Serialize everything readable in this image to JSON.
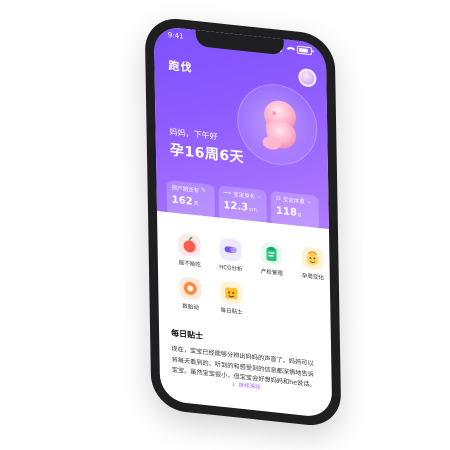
{
  "status_bar": {
    "time": "9:41"
  },
  "app": {
    "title": "跑伐"
  },
  "hero": {
    "greeting": "妈妈，下午好",
    "pregnancy_week_text": "孕16周6天"
  },
  "cards": [
    {
      "label": "预产期还有",
      "value": "162",
      "unit": "天",
      "icon": "edit-icon"
    },
    {
      "label": "宝宝身长",
      "value": "12.3",
      "unit": "cm",
      "icon": "ruler-icon"
    },
    {
      "label": "宝宝体重",
      "value": "118",
      "unit": "g",
      "icon": "scale-icon"
    }
  ],
  "tools": [
    {
      "label": "能不能吃",
      "icon": "apple-icon",
      "color": "#ff6a5a"
    },
    {
      "label": "HCG分析",
      "icon": "capsule-icon",
      "color": "#7a56ff"
    },
    {
      "label": "产检管理",
      "icon": "clipboard-icon",
      "color": "#2bc07c"
    },
    {
      "label": "孕周变化",
      "icon": "baby-face-icon",
      "color": "#ffb200"
    },
    {
      "label": "数胎动",
      "icon": "counter-icon",
      "color": "#ff7a2e"
    },
    {
      "label": "每日贴士",
      "icon": "tips-icon",
      "color": "#ffb200"
    }
  ],
  "tips": {
    "title": "每日贴士",
    "body": "现在，宝宝已经能够分辨出妈妈的声音了。妈妈可以将每天看到的、听到的和感受到的信息都深情地告诉宝宝。虽然宝宝很小，但宝宝会好想妈妈和he说话。"
  },
  "footer": {
    "hint": "继续滑动"
  }
}
